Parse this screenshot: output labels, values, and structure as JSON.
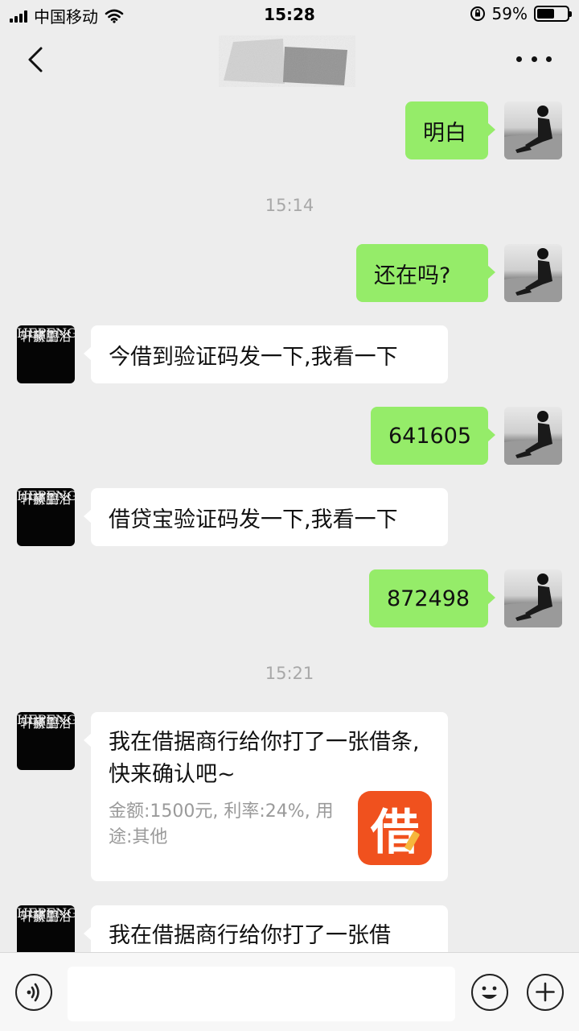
{
  "status_bar": {
    "carrier": "中国移动",
    "time": "15:28",
    "battery_percent": "59%",
    "battery_level": 0.59
  },
  "nav": {
    "back_icon": "chevron-left-icon",
    "more_icon": "more-dots-icon"
  },
  "messages": {
    "m1": "明白",
    "t1": "15:14",
    "m2": "还在吗?",
    "m3": "今借到验证码发一下,我看一下",
    "m4": "641605",
    "m5": "借贷宝验证码发一下,我看一下",
    "m6": "872498",
    "t2": "15:21",
    "card1": {
      "title": "我在借据商行给你打了一张借条, 快来确认吧~",
      "detail": "金额:1500元, 利率:24%, 用途:其他",
      "icon_text": "借"
    },
    "card2": {
      "title": "我在借据商行给你打了一张借"
    }
  },
  "contact_avatar": {
    "line1": "赫鹏",
    "line2": "HEPENG",
    "line3": "轩豪卫浴"
  },
  "input_bar": {
    "placeholder": "",
    "voice_icon": "voice-icon",
    "emoji_icon": "emoji-icon",
    "plus_icon": "plus-icon"
  }
}
